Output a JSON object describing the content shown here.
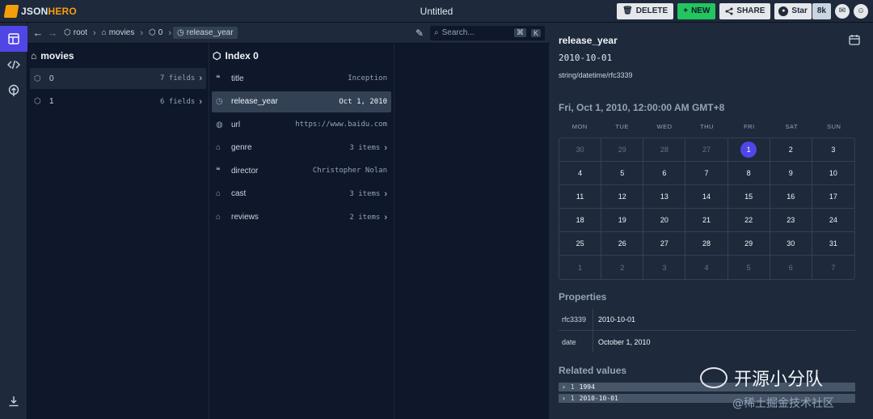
{
  "app": {
    "logo_prefix": "JSON",
    "logo_suffix": "HERO",
    "title": "Untitled"
  },
  "toolbar": {
    "delete_label": "DELETE",
    "new_label": "NEW",
    "share_label": "SHARE",
    "star_label": "Star",
    "star_count": "8k"
  },
  "nav": {
    "crumbs": [
      "root",
      "movies",
      "0",
      "release_year"
    ],
    "search_placeholder": "Search...",
    "shortcut_cmd": "⌘",
    "shortcut_key": "K"
  },
  "column1": {
    "title": "movies",
    "rows": [
      {
        "label": "0",
        "value": "7 fields"
      },
      {
        "label": "1",
        "value": "6 fields"
      }
    ]
  },
  "column2": {
    "title": "Index 0",
    "rows": [
      {
        "icon": "quote-icon",
        "label": "title",
        "value": "Inception"
      },
      {
        "icon": "clock-icon",
        "label": "release_year",
        "value": "Oct 1, 2010"
      },
      {
        "icon": "globe-icon",
        "label": "url",
        "value": "https://www.baidu.com"
      },
      {
        "icon": "array-icon",
        "label": "genre",
        "value": "3 items"
      },
      {
        "icon": "quote-icon",
        "label": "director",
        "value": "Christopher Nolan"
      },
      {
        "icon": "array-icon",
        "label": "cast",
        "value": "3 items"
      },
      {
        "icon": "array-icon",
        "label": "reviews",
        "value": "2 items"
      }
    ]
  },
  "panel": {
    "title": "release_year",
    "value": "2010-10-01",
    "type": "string/datetime/rfc3339",
    "date_heading": "Fri, Oct 1, 2010, 12:00:00 AM GMT+8",
    "weekdays": [
      "MON",
      "TUE",
      "WED",
      "THU",
      "FRI",
      "SAT",
      "SUN"
    ],
    "calendar": [
      [
        "30",
        "29",
        "28",
        "27",
        "1",
        "2",
        "3"
      ],
      [
        "4",
        "5",
        "6",
        "7",
        "8",
        "9",
        "10"
      ],
      [
        "11",
        "12",
        "13",
        "14",
        "15",
        "16",
        "17"
      ],
      [
        "18",
        "19",
        "20",
        "21",
        "22",
        "23",
        "24"
      ],
      [
        "25",
        "26",
        "27",
        "28",
        "29",
        "30",
        "31"
      ],
      [
        "1",
        "2",
        "3",
        "4",
        "5",
        "6",
        "7"
      ]
    ],
    "selected_day": "1",
    "properties_title": "Properties",
    "properties": [
      {
        "key": "rfc3339",
        "value": "2010-10-01"
      },
      {
        "key": "date",
        "value": "October 1, 2010"
      }
    ],
    "related_title": "Related values",
    "related": [
      {
        "count": "1",
        "value": "1994"
      },
      {
        "count": "1",
        "value": "2010-10-01"
      }
    ]
  },
  "watermark": {
    "main": "开源小分队",
    "sub": "@稀土掘金技术社区"
  },
  "colors": {
    "accent": "#4f46e5",
    "new_button": "#22c55e",
    "logo": "#f59e0b"
  }
}
